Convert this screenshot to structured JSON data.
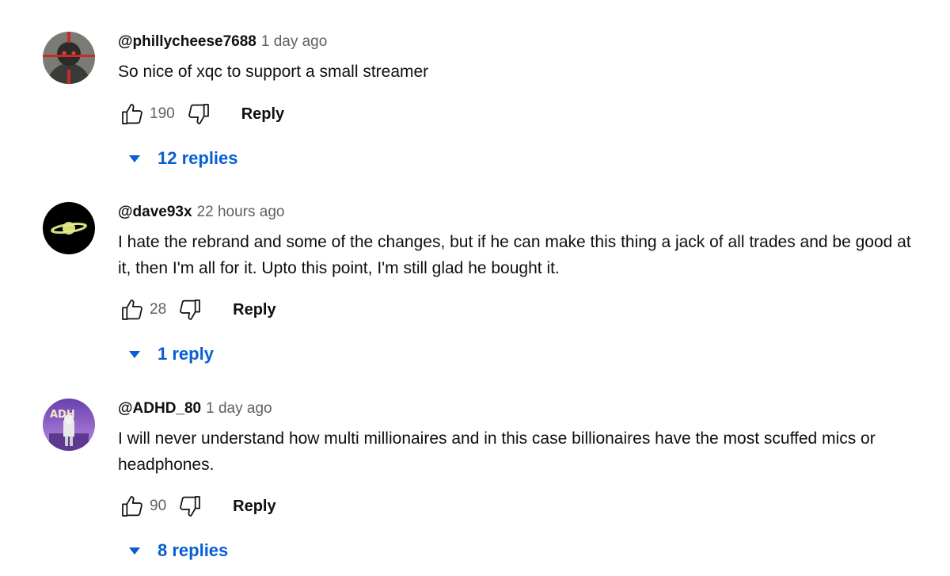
{
  "comments": [
    {
      "author": "@phillycheese7688",
      "time": "1 day ago",
      "text": "So nice of xqc to support a small streamer",
      "likes": "190",
      "reply_label": "Reply",
      "replies_label": "12 replies"
    },
    {
      "author": "@dave93x",
      "time": "22 hours ago",
      "text": "I hate the rebrand and some of the changes, but if he can make this thing a jack of all trades and be good at it, then I'm all for it. Upto this point, I'm still glad he bought it.",
      "likes": "28",
      "reply_label": "Reply",
      "replies_label": "1 reply"
    },
    {
      "author": "@ADHD_80",
      "time": "1 day ago",
      "text": "I will never understand how multi millionaires and in this case billionaires have the most scuffed mics or headphones.",
      "likes": "90",
      "reply_label": "Reply",
      "replies_label": "8 replies",
      "avatar_text": "ADH"
    }
  ],
  "colors": {
    "link": "#065fd4",
    "meta": "#606060",
    "text": "#0f0f0f"
  },
  "icons": [
    "like-icon",
    "dislike-icon",
    "caret-down-icon"
  ]
}
